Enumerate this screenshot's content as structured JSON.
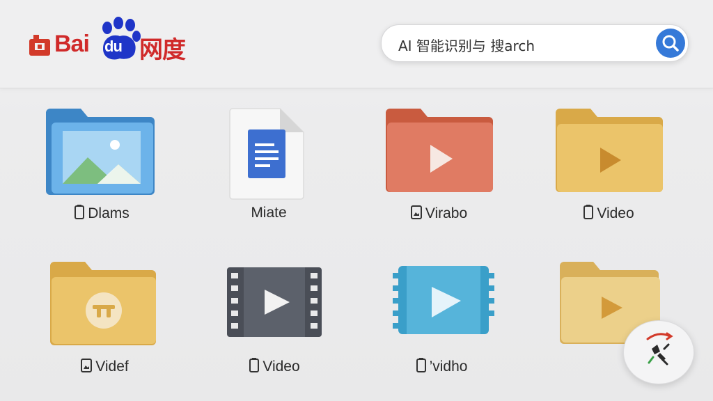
{
  "brand": {
    "logo_bai": "Bai",
    "logo_du": "du",
    "logo_cn": "网度"
  },
  "search": {
    "value": "AI 智能识别与 搜arch",
    "button_icon": "search-icon"
  },
  "colors": {
    "brand_red": "#d02a2a",
    "brand_blue": "#1f35c8",
    "search_blue": "#3579d8"
  },
  "files": [
    {
      "label": "Dlams",
      "icon": "image-folder-icon",
      "glyph": "file-icon"
    },
    {
      "label": "Miate",
      "icon": "document-icon",
      "glyph": ""
    },
    {
      "label": "Virabo",
      "icon": "video-folder-icon",
      "glyph": "image-file-icon"
    },
    {
      "label": "Video",
      "icon": "video-folder-icon",
      "glyph": "file-icon"
    },
    {
      "label": "Videf",
      "icon": "media-folder-icon",
      "glyph": "image-file-icon"
    },
    {
      "label": "Video",
      "icon": "film-icon",
      "glyph": "file-icon"
    },
    {
      "label": "’vidho",
      "icon": "video-file-icon",
      "glyph": "file-icon"
    },
    {
      "label": "",
      "icon": "video-folder-icon",
      "glyph": ""
    }
  ],
  "assistant": {
    "icon": "assistant-icon"
  }
}
